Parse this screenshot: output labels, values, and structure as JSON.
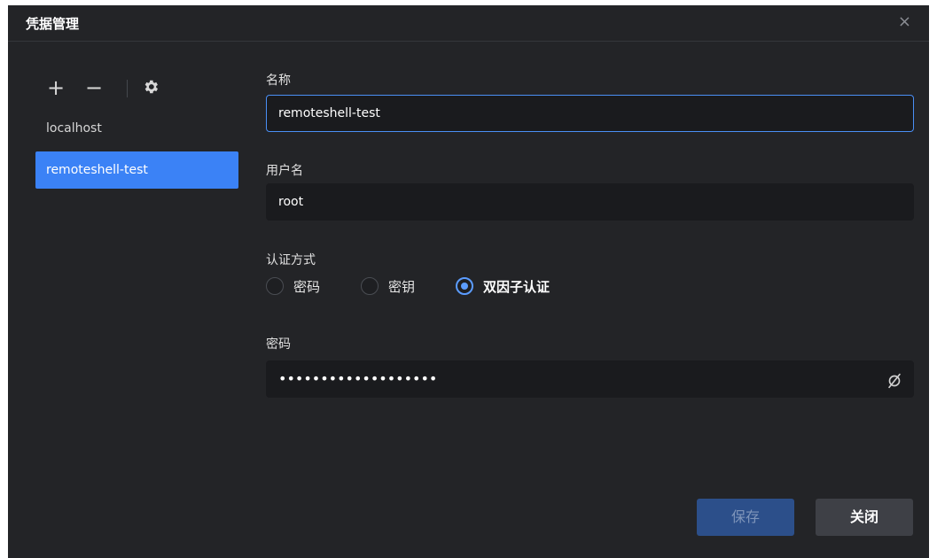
{
  "dialog": {
    "title": "凭据管理",
    "close_glyph": "×"
  },
  "toolbar": {
    "add_glyph": "+",
    "remove_glyph": "−",
    "settings_icon": "gear-icon"
  },
  "credentials": [
    {
      "name": "localhost",
      "selected": false
    },
    {
      "name": "remoteshell-test",
      "selected": true
    }
  ],
  "form": {
    "name_label": "名称",
    "name_value": "remoteshell-test",
    "username_label": "用户名",
    "username_value": "root",
    "auth_label": "认证方式",
    "auth_options": [
      {
        "label": "密码",
        "checked": false
      },
      {
        "label": "密钥",
        "checked": false
      },
      {
        "label": "双因子认证",
        "checked": true
      }
    ],
    "password_label": "密码",
    "password_mask": "•••••••••••••••••••",
    "password_visibility_icon": "eye-off-icon"
  },
  "footer": {
    "save_label": "保存",
    "close_label": "关闭"
  },
  "colors": {
    "accent": "#3b82f6",
    "background": "#232427",
    "field_bg": "#1a1b1e"
  }
}
